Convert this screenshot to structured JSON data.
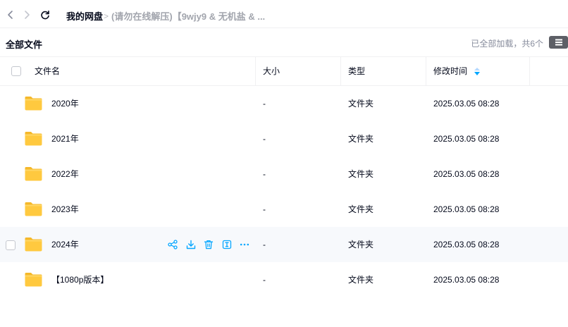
{
  "breadcrumb": {
    "home": "我的网盘",
    "separator": ">",
    "current": "(请勿在线解压)【9wjy9 & 无机盐 & ..."
  },
  "toolbar": {
    "all_files": "全部文件",
    "loaded_status": "已全部加载，共6个"
  },
  "table": {
    "headers": {
      "name": "文件名",
      "size": "大小",
      "type": "类型",
      "modified": "修改时间"
    },
    "rows": [
      {
        "name": "2020年",
        "size": "-",
        "type": "文件夹",
        "modified": "2025.03.05 08:28"
      },
      {
        "name": "2021年",
        "size": "-",
        "type": "文件夹",
        "modified": "2025.03.05 08:28"
      },
      {
        "name": "2022年",
        "size": "-",
        "type": "文件夹",
        "modified": "2025.03.05 08:28"
      },
      {
        "name": "2023年",
        "size": "-",
        "type": "文件夹",
        "modified": "2025.03.05 08:28"
      },
      {
        "name": "2024年",
        "size": "-",
        "type": "文件夹",
        "modified": "2025.03.05 08:28"
      },
      {
        "name": "【1080p版本】",
        "size": "-",
        "type": "文件夹",
        "modified": "2025.03.05 08:28"
      }
    ],
    "hovered_row": 4,
    "row_actions": [
      "share-icon",
      "download-icon",
      "delete-icon",
      "rename-icon",
      "more-icon"
    ]
  },
  "colors": {
    "accent": "#06a7ff",
    "folder": "#ffc93f",
    "hover_row": "#f7f9fc",
    "text_primary": "#03081a",
    "text_muted": "#878c9c"
  },
  "icons": {
    "back": "chevron-left-icon",
    "forward": "chevron-right-icon",
    "refresh": "refresh-icon",
    "menu": "hamburger-menu-icon",
    "folder": "folder-icon",
    "sort": "sort-descending-icon"
  }
}
